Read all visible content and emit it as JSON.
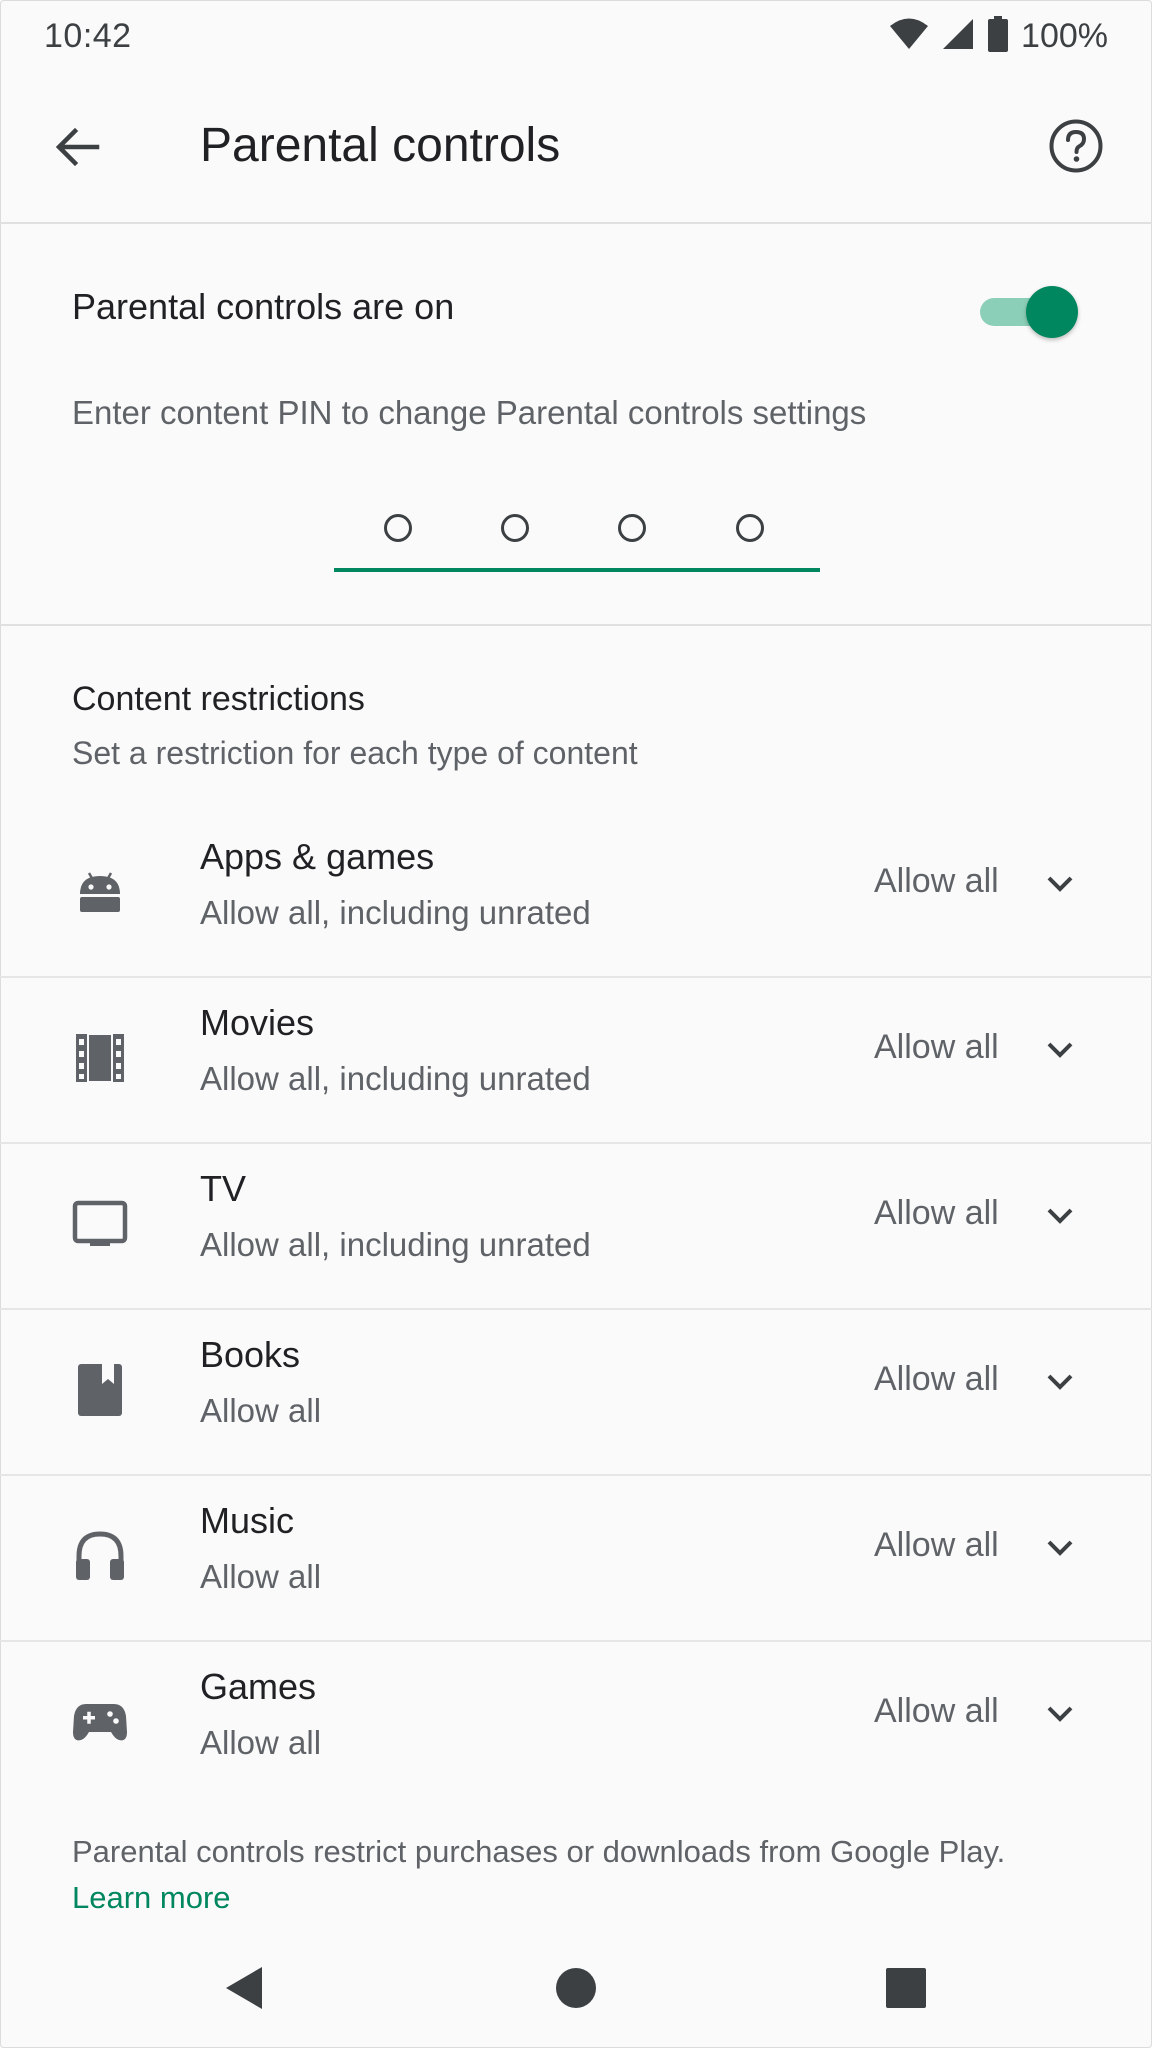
{
  "status_bar": {
    "time": "10:42",
    "battery": "100%",
    "icons": [
      "wifi-icon",
      "cell-signal-icon",
      "battery-icon"
    ]
  },
  "app_bar": {
    "title": "Parental controls",
    "back_icon": "arrow-back-icon",
    "help_icon": "help-circle-icon"
  },
  "toggle": {
    "label": "Parental controls are on",
    "state": "on",
    "accent_color": "#01875f"
  },
  "pin": {
    "prompt": "Enter content PIN to change Parental controls settings",
    "digits": [
      "",
      "",
      "",
      ""
    ]
  },
  "restrictions": {
    "title": "Content restrictions",
    "subtitle": "Set a restriction for each type of content",
    "items": [
      {
        "icon": "android-icon",
        "title": "Apps & games",
        "subtitle": "Allow all, including unrated",
        "value": "Allow all"
      },
      {
        "icon": "movie-film-icon",
        "title": "Movies",
        "subtitle": "Allow all, including unrated",
        "value": "Allow all"
      },
      {
        "icon": "tv-icon",
        "title": "TV",
        "subtitle": "Allow all, including unrated",
        "value": "Allow all"
      },
      {
        "icon": "book-icon",
        "title": "Books",
        "subtitle": "Allow all",
        "value": "Allow all"
      },
      {
        "icon": "headphones-icon",
        "title": "Music",
        "subtitle": "Allow all",
        "value": "Allow all"
      },
      {
        "icon": "gamepad-icon",
        "title": "Games",
        "subtitle": "Allow all",
        "value": "Allow all"
      }
    ]
  },
  "footer": {
    "text": "Parental controls restrict purchases or downloads from Google Play.",
    "link": "Learn more"
  },
  "nav_bar": {
    "icons": [
      "nav-back-icon",
      "nav-home-icon",
      "nav-recents-icon"
    ]
  }
}
